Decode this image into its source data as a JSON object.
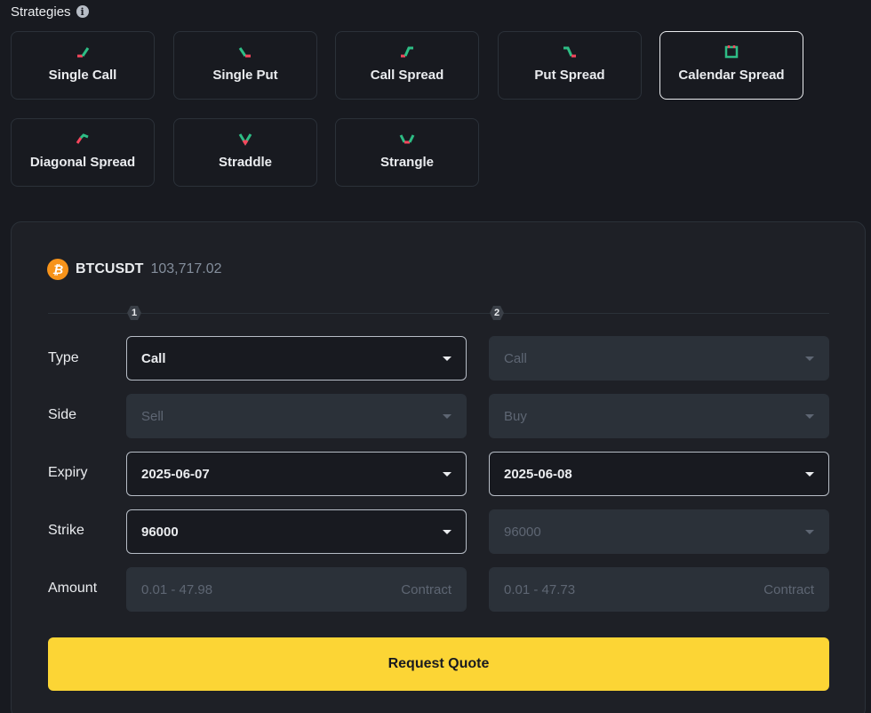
{
  "header": {
    "title": "Strategies",
    "info_glyph": "i"
  },
  "strategies": [
    {
      "label": "Single Call",
      "icon": "single-call-icon",
      "active": false
    },
    {
      "label": "Single Put",
      "icon": "single-put-icon",
      "active": false
    },
    {
      "label": "Call Spread",
      "icon": "call-spread-icon",
      "active": false
    },
    {
      "label": "Put Spread",
      "icon": "put-spread-icon",
      "active": false
    },
    {
      "label": "Calendar Spread",
      "icon": "calendar-icon",
      "active": true
    },
    {
      "label": "Diagonal Spread",
      "icon": "diagonal-spread-icon",
      "active": false
    },
    {
      "label": "Straddle",
      "icon": "straddle-icon",
      "active": false
    },
    {
      "label": "Strangle",
      "icon": "strangle-icon",
      "active": false
    }
  ],
  "pair": {
    "symbol": "BTCUSDT",
    "price": "103,717.02",
    "icon_glyph": "₿"
  },
  "legs": [
    "1",
    "2"
  ],
  "rows": {
    "type": {
      "label": "Type",
      "leg1": "Call",
      "leg2": "Call"
    },
    "side": {
      "label": "Side",
      "leg1": "Sell",
      "leg2": "Buy"
    },
    "expiry": {
      "label": "Expiry",
      "leg1": "2025-06-07",
      "leg2": "2025-06-08"
    },
    "strike": {
      "label": "Strike",
      "leg1": "96000",
      "leg2": "96000"
    },
    "amount": {
      "label": "Amount",
      "leg1_placeholder": "0.01 - 47.98",
      "leg2_placeholder": "0.01 - 47.73",
      "unit": "Contract"
    }
  },
  "actions": {
    "request_quote": "Request Quote"
  },
  "colors": {
    "accent": "#fcd535",
    "up": "#2ebd85",
    "down": "#f6465d",
    "bg": "#181a20"
  }
}
